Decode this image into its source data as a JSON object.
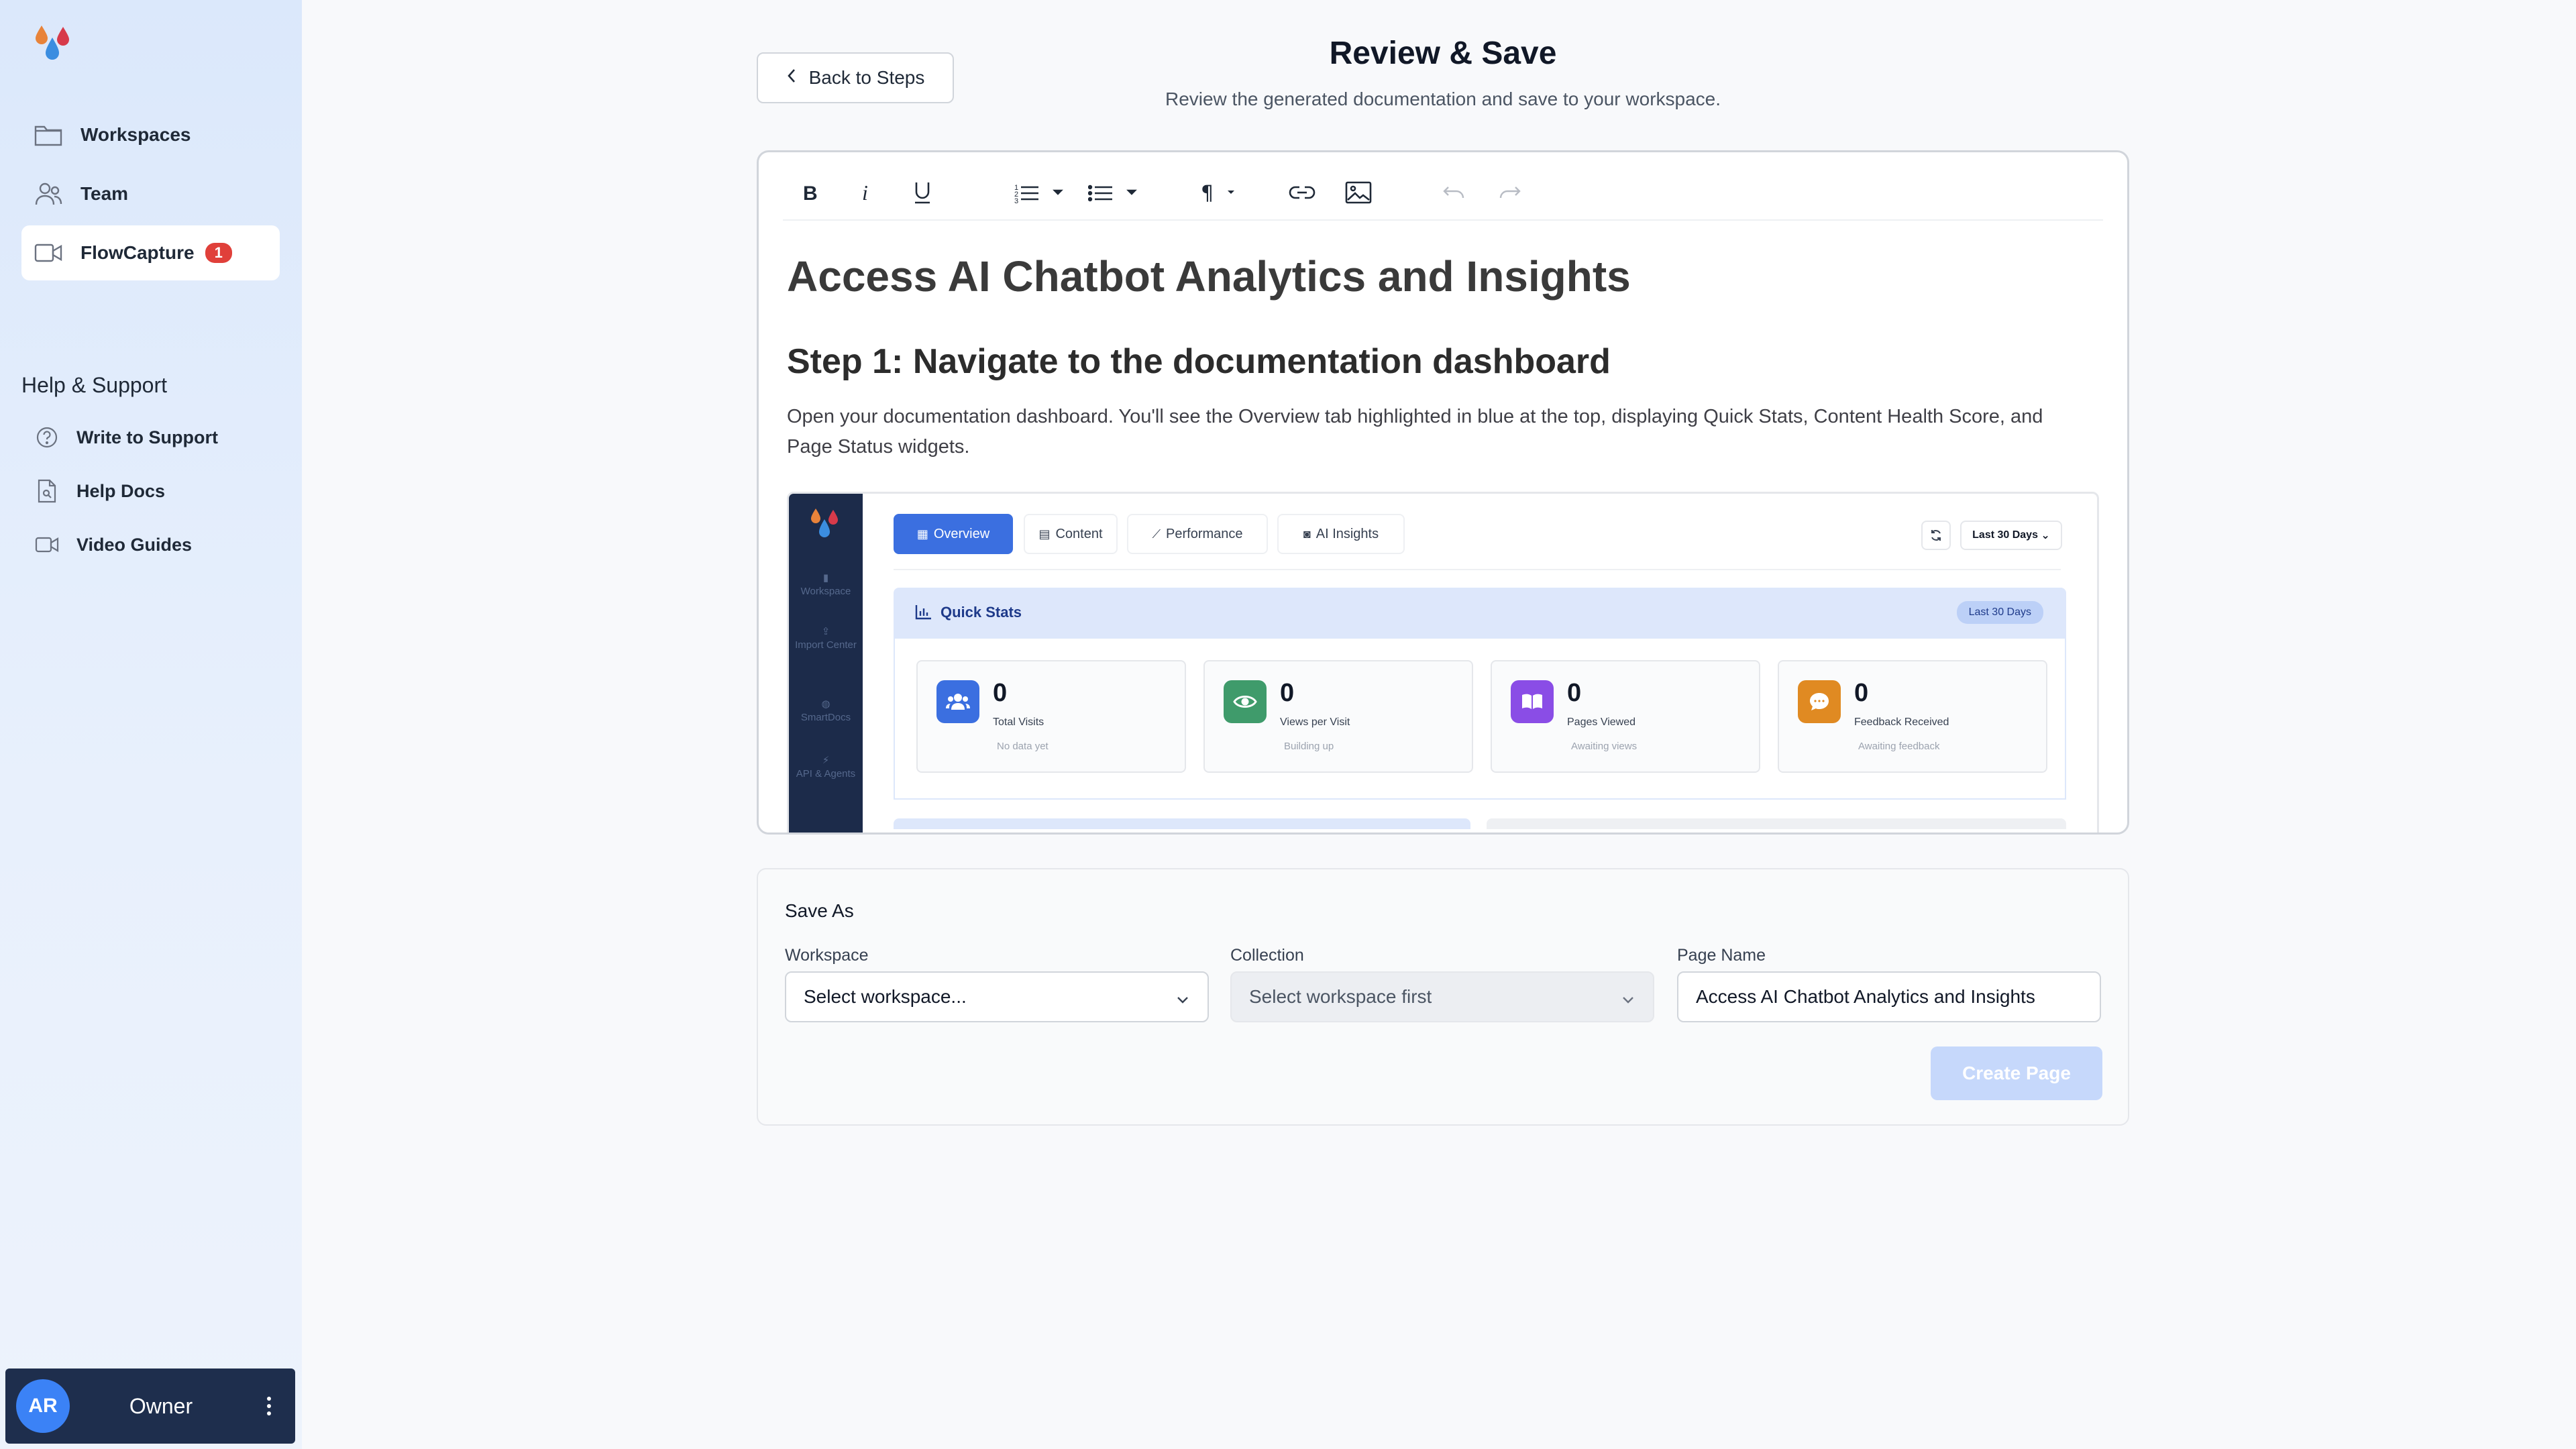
{
  "sidebar": {
    "nav": [
      {
        "label": "Workspaces",
        "icon": "folder-icon"
      },
      {
        "label": "Team",
        "icon": "users-icon"
      },
      {
        "label": "FlowCapture",
        "icon": "video-icon",
        "badge": "1",
        "active": true
      }
    ],
    "help_title": "Help & Support",
    "help": [
      {
        "label": "Write to Support",
        "icon": "question-circle-icon"
      },
      {
        "label": "Help Docs",
        "icon": "document-icon"
      },
      {
        "label": "Video Guides",
        "icon": "video-icon"
      }
    ],
    "user": {
      "initials": "AR",
      "role": "Owner"
    }
  },
  "header": {
    "back_label": "Back to Steps",
    "title": "Review & Save",
    "subtitle": "Review the generated documentation and save to your workspace."
  },
  "editor": {
    "toolbar": [
      "bold-icon",
      "italic-icon",
      "underline-icon",
      "ordered-list-icon",
      "bullet-list-icon",
      "paragraph-icon",
      "link-icon",
      "image-icon",
      "undo-icon",
      "redo-icon"
    ],
    "h1": "Access AI Chatbot Analytics and Insights",
    "h2": "Step 1: Navigate to the documentation dashboard",
    "paragraph": "Open your documentation dashboard. You'll see the Overview tab highlighted in blue at the top, displaying Quick Stats, Content Health Score, and Page Status widgets.",
    "screenshot": {
      "side_items": [
        "Workspace",
        "Import Center",
        "SmartDocs",
        "API & Agents"
      ],
      "tabs": [
        "Overview",
        "Content",
        "Performance",
        "AI Insights"
      ],
      "range": "Last 30 Days",
      "quick_stats_title": "Quick Stats",
      "quick_stats_badge": "Last 30 Days",
      "cards": [
        {
          "value": "0",
          "label": "Total Visits",
          "sub": "No data yet",
          "color": "#3b6fe0"
        },
        {
          "value": "0",
          "label": "Views per Visit",
          "sub": "Building up",
          "color": "#3f9b6b"
        },
        {
          "value": "0",
          "label": "Pages Viewed",
          "sub": "Awaiting views",
          "color": "#8a4de6"
        },
        {
          "value": "0",
          "label": "Feedback Received",
          "sub": "Awaiting feedback",
          "color": "#e08a22"
        }
      ]
    }
  },
  "save": {
    "title": "Save As",
    "workspace_label": "Workspace",
    "workspace_value": "Select workspace...",
    "collection_label": "Collection",
    "collection_value": "Select workspace first",
    "page_name_label": "Page Name",
    "page_name_value": "Access AI Chatbot Analytics and Insights",
    "create_label": "Create Page"
  }
}
